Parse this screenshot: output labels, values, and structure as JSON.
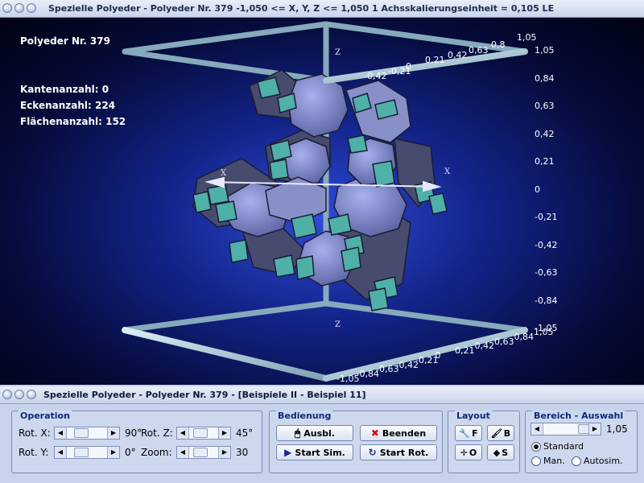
{
  "window_main": {
    "title": "Spezielle Polyeder - Polyeder Nr. 379   -1,050 <= X, Y, Z <= 1,050    1 Achsskalierungseinheit = 0,105 LE"
  },
  "window_panel": {
    "title": "Spezielle Polyeder - Polyeder Nr. 379 - [Beispiele II - Beispiel 11]"
  },
  "info": {
    "name": "Polyeder Nr. 379",
    "kanten": "Kantenanzahl: 0",
    "ecken": "Eckenanzahl: 224",
    "flaechen": "Flächenanzahl: 152"
  },
  "axes": {
    "right_labels": [
      "1,05",
      "0,84",
      "0,63",
      "0,42",
      "0,21",
      "0",
      "-0,21",
      "-0,42",
      "-0,63",
      "-0,84",
      "-1,05"
    ],
    "top_labels": [
      "0,21",
      "0,42",
      "0,63",
      "0,8",
      "1,05"
    ],
    "top_left_labels": [
      "-0,42",
      "-0,21",
      "0"
    ],
    "bottom_labels": [
      "-1,05",
      "-0,84",
      "-0,63",
      "-0,42",
      "-0,21",
      "0",
      "0,21",
      "0,42",
      "0,63",
      "0,84",
      "1,05"
    ],
    "x_label": "X",
    "z_label": "Z"
  },
  "operation": {
    "title": "Operation",
    "rot_x_label": "Rot. X:",
    "rot_x_value": "90°",
    "rot_y_label": "Rot. Y:",
    "rot_y_value": "0°",
    "rot_z_label": "Rot. Z:",
    "rot_z_value": "45°",
    "zoom_label": "Zoom:",
    "zoom_value": "30"
  },
  "bedienung": {
    "title": "Bedienung",
    "ausbl": "Ausbl.",
    "beenden": "Beenden",
    "start_sim": "Start Sim.",
    "start_rot": "Start Rot."
  },
  "layout": {
    "title": "Layout",
    "f": "F",
    "b": "B",
    "o": "O",
    "s": "S"
  },
  "bereich": {
    "title": "Bereich - Auswahl",
    "value": "1,05",
    "standard": "Standard",
    "man": "Man.",
    "autosim": "Autosim.",
    "selected": "Standard"
  },
  "colors": {
    "face_dark": "#474b6e",
    "face_light": "#8e96d6",
    "square": "#4fb0a8",
    "frame": "#9ec0d0",
    "background": "#13248a"
  }
}
